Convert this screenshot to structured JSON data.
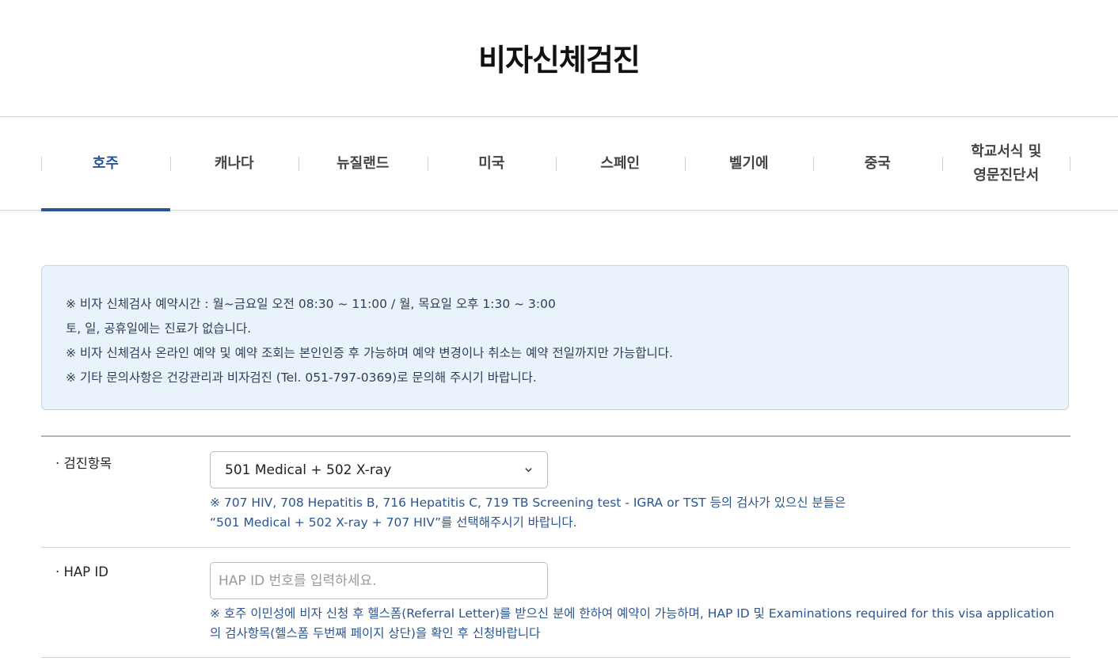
{
  "page": {
    "title": "비자신체검진"
  },
  "tabs": [
    {
      "label": "호주",
      "active": true
    },
    {
      "label": "캐나다",
      "active": false
    },
    {
      "label": "뉴질랜드",
      "active": false
    },
    {
      "label": "미국",
      "active": false
    },
    {
      "label": "스페인",
      "active": false
    },
    {
      "label": "벨기에",
      "active": false
    },
    {
      "label": "중국",
      "active": false
    },
    {
      "label_line1": "학교서식 및",
      "label_line2": "영문진단서",
      "active": false
    }
  ],
  "notice": {
    "lines": [
      "※ 비자 신체검사 예약시간 : 월~금요일 오전 08:30 ~ 11:00 / 월, 목요일 오후 1:30 ~ 3:00",
      "토, 일, 공휴일에는 진료가 없습니다.",
      "※ 비자 신체검사 온라인 예약 및 예약 조회는 본인인증 후 가능하며 예약 변경이나 취소는 예약 전일까지만 가능합니다.",
      "※ 기타 문의사항은 건강관리과 비자검진 (Tel. 051-797-0369)로 문의해 주시기 바랍니다."
    ]
  },
  "form": {
    "exam": {
      "label": "· 검진항목",
      "selected": "501 Medical + 502 X-ray",
      "note_line1": "※ 707 HIV, 708 Hepatitis B, 716 Hepatitis C, 719 TB Screening test - IGRA or TST 등의 검사가 있으신 분들은",
      "note_line2": "“501 Medical + 502 X-ray + 707 HIV”를 선택해주시기 바랍니다."
    },
    "hap": {
      "label": "· HAP ID",
      "value": "",
      "placeholder": "HAP ID 번호를 입력하세요.",
      "note_line1": "※ 호주 이민성에 비자 신청 후 헬스폼(Referral Letter)를 받으신 분에 한하여 예약이 가능하며, HAP ID 및 Examinations required for this visa application",
      "note_line2": "의 검사항목(헬스폼 두번째 페이지 상단)을 확인 후 신청바랍니다"
    }
  },
  "colors": {
    "accent": "#2a5592",
    "notice_bg": "#eaf2fb"
  },
  "icons": {
    "select_arrow": "chevron-down-icon"
  }
}
